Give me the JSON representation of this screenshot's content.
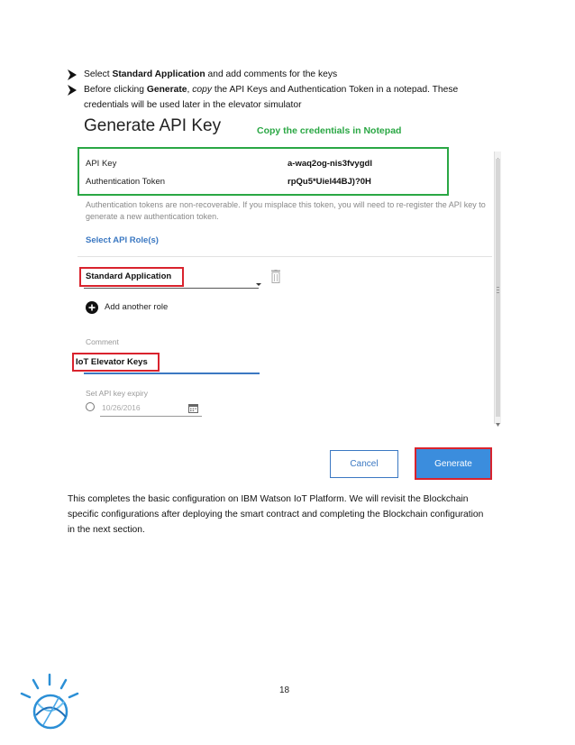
{
  "instructions": {
    "item1": {
      "prefix": "Select ",
      "bold": "Standard Application",
      "suffix": " and add comments for the keys"
    },
    "item2": {
      "prefix": "Before clicking ",
      "bold": "Generate",
      "sep": ", ",
      "italic": "copy",
      "suffix": " the API Keys and Authentication Token in a notepad. These",
      "line2": "credentials will be used later in the elevator simulator"
    }
  },
  "screenshot": {
    "title": "Generate API Key",
    "annotation": "Copy the credentials in Notepad",
    "api_key_label": "API Key",
    "api_key_value": "a-waq2og-nis3fvygdl",
    "auth_token_label": "Authentication Token",
    "auth_token_value": "rpQu5*Uiel44BJ)?0H",
    "note_line1": "Authentication tokens are non-recoverable. If you misplace this token, you will need to re-register the API key to",
    "note_line2": "generate a new authentication token.",
    "select_role_link": "Select API Role(s)",
    "role_value": "Standard Application",
    "add_role_label": "Add another role",
    "comment_label": "Comment",
    "comment_value": "IoT Elevator Keys",
    "expiry_label": "Set API key expiry",
    "expiry_date": "10/26/2016",
    "cancel_label": "Cancel",
    "generate_label": "Generate"
  },
  "closing": {
    "line1": "This completes the basic configuration on IBM Watson IoT Platform. We will revisit the Blockchain",
    "line2": "specific configurations after deploying the smart contract and completing the Blockchain configuration",
    "line3": "in the next section."
  },
  "page_number": "18",
  "colors": {
    "annotation_green": "#2aa744",
    "highlight_red": "#d9232d",
    "primary_blue": "#3b8ddd",
    "link_blue": "#3b78c2"
  }
}
